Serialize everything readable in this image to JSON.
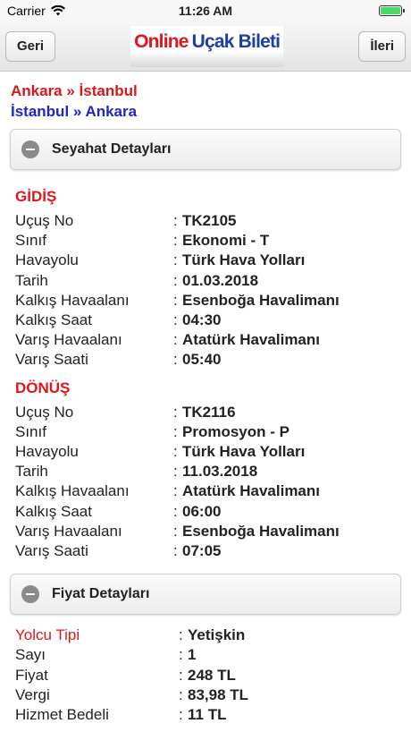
{
  "status": {
    "carrier": "Carrier",
    "time": "11:26 AM"
  },
  "nav": {
    "back_label": "Geri",
    "forward_label": "İleri",
    "logo_part1": "Online",
    "logo_part2": "Uçak Bileti"
  },
  "route": {
    "outbound": "Ankara » İstanbul",
    "return": "İstanbul » Ankara"
  },
  "travel_section": {
    "title": "Seyahat Detayları"
  },
  "outbound": {
    "title": "GİDİŞ",
    "rows": [
      {
        "label": "Uçuş No",
        "value": "TK2105"
      },
      {
        "label": "Sınıf",
        "value": "Ekonomi - T"
      },
      {
        "label": "Havayolu",
        "value": "Türk Hava Yolları"
      },
      {
        "label": "Tarih",
        "value": "01.03.2018"
      },
      {
        "label": "Kalkış Havaalanı",
        "value": "Esenboğa Havalimanı"
      },
      {
        "label": "Kalkış Saat",
        "value": "04:30"
      },
      {
        "label": "Varış Havaalanı",
        "value": "Atatürk Havalimanı"
      },
      {
        "label": "Varış Saati",
        "value": "05:40"
      }
    ]
  },
  "return_leg": {
    "title": "DÖNÜŞ",
    "rows": [
      {
        "label": "Uçuş No",
        "value": "TK2116"
      },
      {
        "label": "Sınıf",
        "value": "Promosyon - P"
      },
      {
        "label": "Havayolu",
        "value": "Türk Hava Yolları"
      },
      {
        "label": "Tarih",
        "value": "11.03.2018"
      },
      {
        "label": "Kalkış Havaalanı",
        "value": "Atatürk Havalimanı"
      },
      {
        "label": "Kalkış Saat",
        "value": "06:00"
      },
      {
        "label": "Varış Havaalanı",
        "value": "Esenboğa Havalimanı"
      },
      {
        "label": "Varış Saati",
        "value": "07:05"
      }
    ]
  },
  "price_section": {
    "title": "Fiyat Detayları"
  },
  "price": {
    "rows": [
      {
        "label": "Yolcu Tipi",
        "value": "Yetişkin"
      },
      {
        "label": "Sayı",
        "value": "1"
      },
      {
        "label": "Fiyat",
        "value": "248 TL"
      },
      {
        "label": "Vergi",
        "value": "83,98 TL"
      },
      {
        "label": "Hizmet Bedeli",
        "value": "11 TL"
      }
    ]
  },
  "separator": ":",
  "colors": {
    "accent_red": "#e0161c",
    "accent_blue": "#1e27c8",
    "battery": "#4cd964"
  },
  "icons": {
    "wifi": "wifi-icon",
    "battery": "battery-icon",
    "collapse": "minus-circle-icon"
  }
}
